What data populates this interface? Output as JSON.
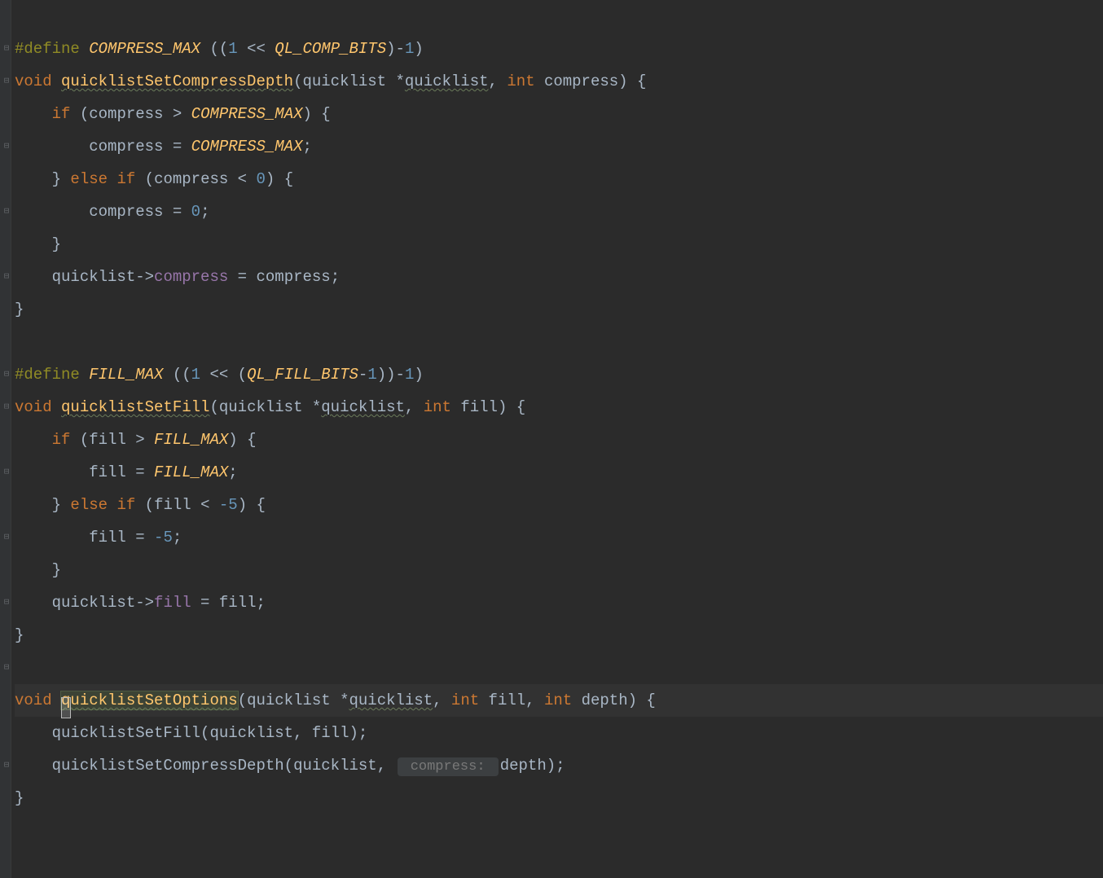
{
  "code": {
    "lines": [
      {
        "type": "define",
        "t1": "#define",
        "sp1": " ",
        "name": "COMPRESS_MAX",
        "sp2": " ",
        "rest_open": "((",
        "n1": "1",
        "rest_mid": " << ",
        "macro_ref": "QL_COMP_BITS",
        "rest_close": ")-",
        "n2": "1",
        "tail": ")"
      },
      {
        "type": "fnsig1",
        "ret": "void",
        "sp": " ",
        "fn": "quicklistSetCompressDepth",
        "open": "(",
        "p1": "quicklist *",
        "p1n": "quicklist",
        "c": ", ",
        "p2t": "int",
        "sp2": " ",
        "p2n": "compress",
        "close": ") {"
      },
      {
        "type": "if",
        "indent": "    ",
        "kw": "if",
        "rest_open": " (",
        "var": "compress",
        "op": " > ",
        "mac": "COMPRESS_MAX",
        "rest_close": ") {"
      },
      {
        "type": "assign_mac",
        "indent": "        ",
        "var": "compress",
        "eq": " = ",
        "mac": "COMPRESS_MAX",
        "semi": ";"
      },
      {
        "type": "elseif",
        "indent": "    ",
        "close": "}",
        "sp": " ",
        "kw1": "else",
        "sp2": " ",
        "kw2": "if",
        "open": " (",
        "var": "compress",
        "op": " < ",
        "num": "0",
        "tail": ") {"
      },
      {
        "type": "assign_num",
        "indent": "        ",
        "var": "compress",
        "eq": " = ",
        "num": "0",
        "semi": ";"
      },
      {
        "type": "closebrace",
        "indent": "    ",
        "close": "}"
      },
      {
        "type": "member_assign",
        "indent": "    ",
        "obj": "quicklist",
        "arrow": "->",
        "mem": "compress",
        "eq": " = ",
        "val": "compress",
        "semi": ";"
      },
      {
        "type": "closebrace",
        "indent": "",
        "close": "}"
      },
      {
        "type": "blank"
      },
      {
        "type": "define2",
        "t1": "#define",
        "sp1": " ",
        "name": "FILL_MAX",
        "sp2": " ",
        "open": "((",
        "n1": "1",
        "mid1": " << (",
        "mac": "QL_FILL_BITS",
        "mid2": "-",
        "n2": "1",
        "mid3": "))-",
        "n3": "1",
        "close": ")"
      },
      {
        "type": "fnsig2",
        "ret": "void",
        "sp": " ",
        "fn": "quicklistSetFill",
        "open": "(",
        "p1": "quicklist *",
        "p1n": "quicklist",
        "c": ", ",
        "p2t": "int",
        "sp2": " ",
        "p2n": "fill",
        "close": ") {"
      },
      {
        "type": "if2",
        "indent": "    ",
        "kw": "if",
        "open": " (",
        "var": "fill",
        "op": " > ",
        "mac": "FILL_MAX",
        "close": ") {"
      },
      {
        "type": "assign_mac2",
        "indent": "        ",
        "var": "fill",
        "eq": " = ",
        "mac": "FILL_MAX",
        "semi": ";"
      },
      {
        "type": "elseif2",
        "indent": "    ",
        "close": "}",
        "sp": " ",
        "kw1": "else",
        "sp2": " ",
        "kw2": "if",
        "open": " (",
        "var": "fill",
        "op": " < ",
        "num": "-5",
        "tail": ") {"
      },
      {
        "type": "assign_num2",
        "indent": "        ",
        "var": "fill",
        "eq": " = ",
        "num": "-5",
        "semi": ";"
      },
      {
        "type": "closebrace2",
        "indent": "    ",
        "close": "}"
      },
      {
        "type": "member_assign2",
        "indent": "    ",
        "obj": "quicklist",
        "arrow": "->",
        "mem": "fill",
        "eq": " = ",
        "val": "fill",
        "semi": ";"
      },
      {
        "type": "closebrace3",
        "indent": "",
        "close": "}"
      },
      {
        "type": "blank"
      },
      {
        "type": "fnsig3",
        "ret": "void",
        "sp": " ",
        "fn": "quicklistSetOptions",
        "open": "(",
        "p1": "quicklist *",
        "p1n": "quicklist",
        "c": ", ",
        "p2t": "int",
        "sp2": " ",
        "p2n": "fill",
        "c2": ", ",
        "p3t": "int",
        "sp3": " ",
        "p3n": "depth",
        "close": ") {"
      },
      {
        "type": "call1",
        "indent": "    ",
        "fn": "quicklistSetFill",
        "open": "(",
        "a1": "quicklist",
        "c": ", ",
        "a2": "fill",
        "close": ");"
      },
      {
        "type": "call2",
        "indent": "    ",
        "fn": "quicklistSetCompressDepth",
        "open": "(",
        "a1": "quicklist",
        "c": ", ",
        "hint": " compress: ",
        "a2": "depth",
        "close": ");"
      },
      {
        "type": "closebrace4",
        "indent": "",
        "close": "}"
      }
    ]
  },
  "colors": {
    "keyword": "#cc7832",
    "macro": "#ffc66d",
    "number": "#6897bb",
    "member": "#9876aa",
    "default": "#a9b7c6",
    "define": "#908b25"
  }
}
